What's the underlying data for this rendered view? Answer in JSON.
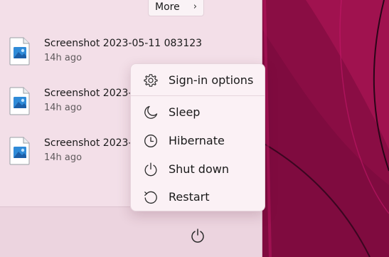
{
  "recommended": {
    "more_label": "More",
    "more_icon": "chevron-right-icon",
    "items": [
      {
        "name": "Screenshot 2023-05-11 083123",
        "time": "14h ago",
        "icon": "image-file-icon"
      },
      {
        "name": "Screenshot 2023-05-11 083123",
        "time": "14h ago",
        "icon": "image-file-icon"
      },
      {
        "name": "Screenshot 2023-05-11 083123",
        "time": "14h ago",
        "icon": "image-file-icon"
      }
    ]
  },
  "power_menu": {
    "items": [
      {
        "label": "Sign-in options",
        "icon": "gear-icon"
      },
      {
        "label": "Sleep",
        "icon": "moon-icon"
      },
      {
        "label": "Hibernate",
        "icon": "clock-icon"
      },
      {
        "label": "Shut down",
        "icon": "power-icon"
      },
      {
        "label": "Restart",
        "icon": "restart-icon"
      }
    ]
  },
  "footer": {
    "power_icon": "power-icon"
  },
  "colors": {
    "start_background": "#f3dfe8",
    "menu_background": "#fbf1f5",
    "wallpaper_base": "#8b0f45",
    "wallpaper_accent": "#c21868"
  }
}
